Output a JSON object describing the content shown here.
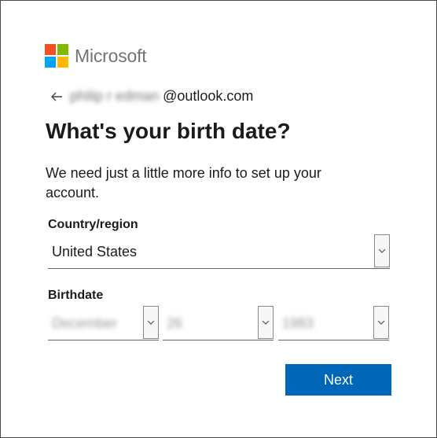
{
  "brand": {
    "name": "Microsoft",
    "colors": {
      "red": "#f25022",
      "green": "#7fba00",
      "blue": "#00a4ef",
      "yellow": "#ffb900",
      "primary_button": "#0067b8"
    }
  },
  "identity": {
    "back_icon": "arrow-left-icon",
    "email_masked_prefix": "philip r",
    "email_masked_middle": "edman",
    "email_domain": "@outlook.com"
  },
  "heading": {
    "title": "What's your birth date?",
    "description": "We need just a little more info to set up your account."
  },
  "country": {
    "label": "Country/region",
    "selected": "United States"
  },
  "birthdate": {
    "label": "Birthdate",
    "month": "December",
    "day": "26",
    "year": "1983"
  },
  "actions": {
    "next_label": "Next"
  }
}
